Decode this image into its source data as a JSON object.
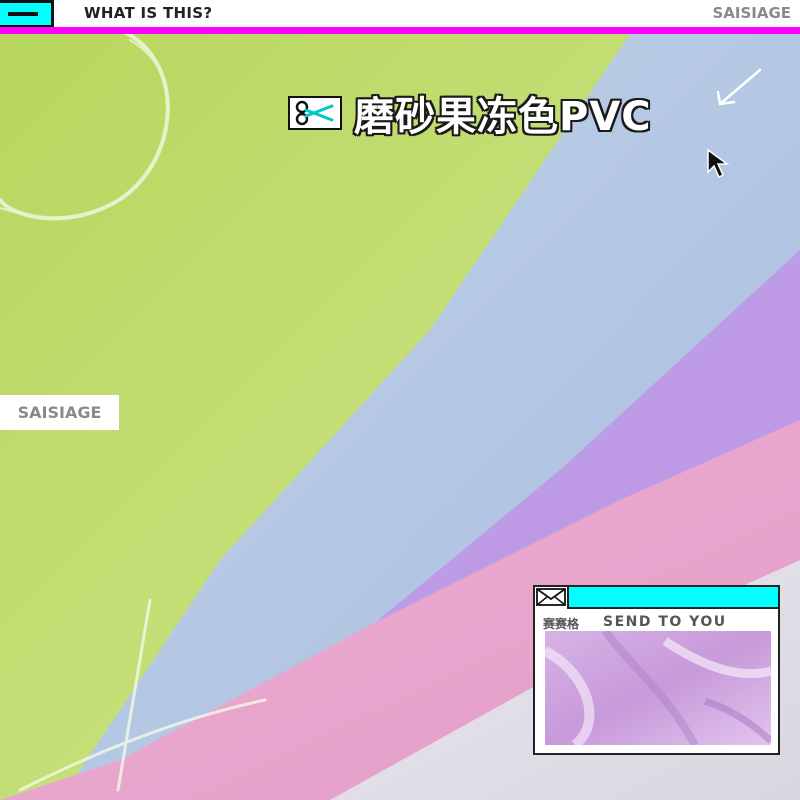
{
  "top_bar": {
    "question": "WHAT IS THIS?",
    "brand": "SAISIAGE",
    "accent_color": "#ff00ff",
    "window_button_color": "#00ffff"
  },
  "headline": {
    "text": "磨砂果冻色PVC",
    "icon": "scissors-icon"
  },
  "side_tag": {
    "brand": "SAISIAGE"
  },
  "card": {
    "brand": "赛赛格",
    "title": "SEND TO YOU",
    "icon": "envelope-icon",
    "header_color": "#00ffff"
  },
  "fabric_colors": {
    "green": "#c3dc74",
    "blue": "#b9c9e0",
    "purple": "#c9a6e4",
    "pink": "#e6a6cc"
  }
}
